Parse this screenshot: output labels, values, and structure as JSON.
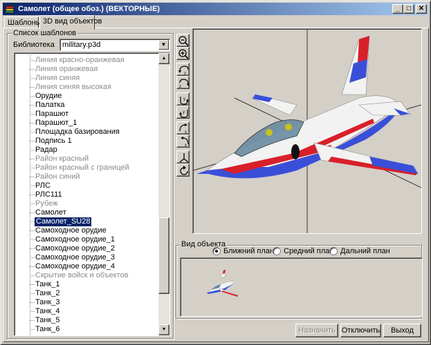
{
  "window": {
    "title": "Самолет (общее обоз.) (ВЕКТОРНЫЕ)",
    "buttons": {
      "minimize": "_",
      "maximize": "□",
      "close": "✕"
    }
  },
  "tabs": [
    {
      "label": "Шаблоны",
      "active": false
    },
    {
      "label": "3D вид объектов",
      "active": true
    }
  ],
  "templates_group": {
    "title": "Список шаблонов",
    "library_label": "Библиотека",
    "library_value": "military.p3d",
    "items": [
      {
        "label": "Линия красно-оранжевая",
        "enabled": false
      },
      {
        "label": "Линия оранжевая",
        "enabled": false
      },
      {
        "label": "Линия синяя",
        "enabled": false
      },
      {
        "label": "Линия синяя высокая",
        "enabled": false
      },
      {
        "label": "Орудие",
        "enabled": true
      },
      {
        "label": "Палатка",
        "enabled": true
      },
      {
        "label": "Парашют",
        "enabled": true
      },
      {
        "label": "Парашют_1",
        "enabled": true
      },
      {
        "label": "Площадка базирования",
        "enabled": true
      },
      {
        "label": "Подпись 1",
        "enabled": true
      },
      {
        "label": "Радар",
        "enabled": true
      },
      {
        "label": "Район красный",
        "enabled": false
      },
      {
        "label": "Район красный с границей",
        "enabled": false
      },
      {
        "label": "Район синий",
        "enabled": false
      },
      {
        "label": "РЛС",
        "enabled": true
      },
      {
        "label": "РЛС111",
        "enabled": true
      },
      {
        "label": "Рубеж",
        "enabled": false
      },
      {
        "label": "Самолет",
        "enabled": true
      },
      {
        "label": "Самолет_SU28",
        "enabled": true,
        "selected": true
      },
      {
        "label": "Самоходное орудие",
        "enabled": true
      },
      {
        "label": "Самоходное орудие_1",
        "enabled": true
      },
      {
        "label": "Самоходное орудие_2",
        "enabled": true
      },
      {
        "label": "Самоходное орудие_3",
        "enabled": true
      },
      {
        "label": "Самоходное орудие_4",
        "enabled": true
      },
      {
        "label": "Скрытие войск и объектов",
        "enabled": false
      },
      {
        "label": "Танк_1",
        "enabled": true
      },
      {
        "label": "Танк_2",
        "enabled": true
      },
      {
        "label": "Танк_3",
        "enabled": true
      },
      {
        "label": "Танк_4",
        "enabled": true
      },
      {
        "label": "Танк_5",
        "enabled": true
      },
      {
        "label": "Танк_6",
        "enabled": true
      }
    ]
  },
  "toolbar": {
    "tools": [
      "zoom-out-icon",
      "zoom-in-icon",
      "rotate-z-ccw-icon",
      "rotate-z-cw-icon",
      "rotate-y-ccw-icon",
      "rotate-y-cw-icon",
      "rotate-x-ccw-icon",
      "rotate-x-cw-icon",
      "axes-icon",
      "reset-view-icon"
    ]
  },
  "view_group": {
    "title": "Вид объекта",
    "options": [
      {
        "label": "Ближний план",
        "checked": true
      },
      {
        "label": "Средний план",
        "checked": false
      },
      {
        "label": "Дальний план",
        "checked": false
      }
    ]
  },
  "footer": {
    "assign": "Назначить",
    "disable": "Отключить",
    "exit": "Выход"
  },
  "colors": {
    "title_bar": "#0a246a",
    "selection": "#0a246a",
    "aircraft_blue": "#3a4fd8",
    "aircraft_red": "#d8202a",
    "aircraft_white": "#f2f2f2"
  }
}
